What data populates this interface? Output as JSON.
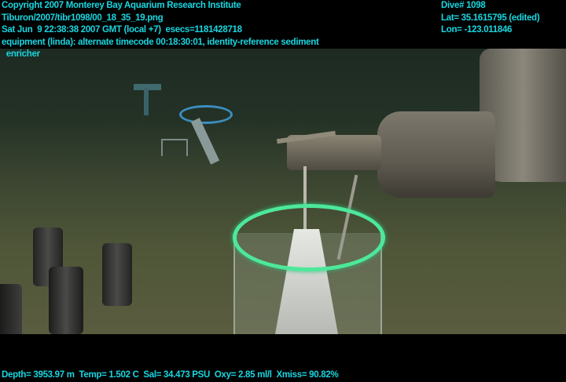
{
  "overlay": {
    "top_left": [
      "Copyright 2007 Monterey Bay Aquarium Research Institute",
      "Tiburon/2007/tibr1098/00_18_35_19.png",
      "Sat Jun  9 22:38:38 2007 GMT (local +7)  esecs=1181428718",
      "equipment (linda): alternate timecode 00:18:30:01, identity-reference sediment",
      "  enricher"
    ],
    "top_right": [
      "Dive# 1098",
      "Lat= 35.1615795 (edited)",
      "Lon= -123.011846"
    ],
    "bottom": "Depth= 3953.97 m  Temp= 1.502 C  Sal= 34.473 PSU  Oxy= 2.85 ml/l  Xmiss= 90.82%"
  },
  "colors": {
    "overlay_text": "#19d6e0",
    "ring": "#4de89a"
  }
}
